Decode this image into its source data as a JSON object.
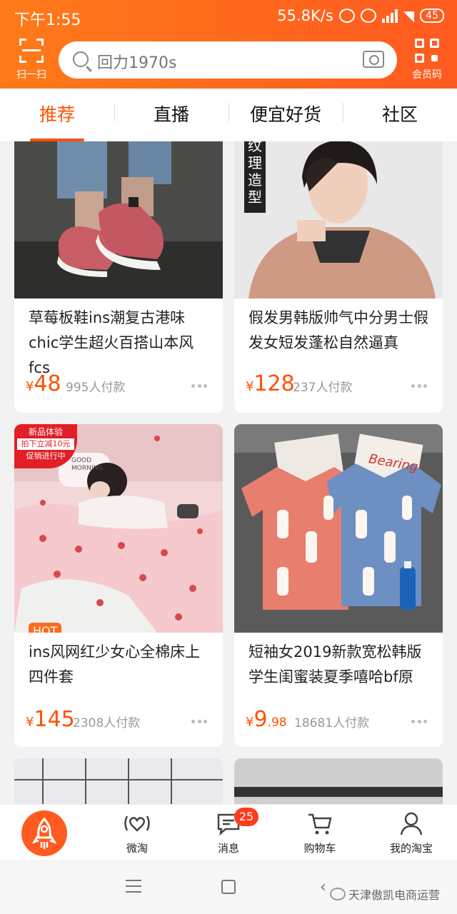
{
  "status_bar": {
    "time": "下午1:55",
    "speed": "55.8K/s",
    "battery": "45"
  },
  "header": {
    "scan_label": "扫一扫",
    "search_placeholder": "回力1970s",
    "member_label": "会员码"
  },
  "tabs": [
    "推荐",
    "直播",
    "便宜好货",
    "社区"
  ],
  "products": [
    {
      "title": "草莓板鞋ins潮复古港味chic学生超火百搭山本风fcs",
      "price_yen": "¥",
      "price_int": "48",
      "price_dec": "",
      "paid": "995人付款"
    },
    {
      "title": "假发男韩版帅气中分男士假发女短发蓬松自然逼真",
      "price_yen": "¥",
      "price_int": "128",
      "price_dec": "",
      "paid": "237人付款",
      "overlay_text": "纹理造型"
    },
    {
      "title": "ins风网红少女心全棉床上四件套",
      "price_yen": "¥",
      "price_int": "145",
      "price_dec": "",
      "paid": "2308人付款",
      "badge_lines": [
        "新品体验",
        "拍下立减10元",
        "促销进行中"
      ],
      "hot": "HOT",
      "pillow_text": "GOOD MORNING"
    },
    {
      "title": "短袖女2019新款宽松韩版学生闺蜜装夏季嘻哈bf原",
      "price_yen": "¥",
      "price_int": "9",
      "price_dec": ".98",
      "paid": "18681人付款",
      "sign_text": "Bearing"
    }
  ],
  "tabbar": {
    "home": "",
    "weitao": "微淘",
    "messages": "消息",
    "messages_badge": "25",
    "cart": "购物车",
    "mine": "我的淘宝"
  },
  "watermark": "天津傲凯电商运营",
  "colors": {
    "brand_orange": "#ff5000",
    "header_start": "#ff7a1a",
    "header_end": "#ff5a1f"
  }
}
